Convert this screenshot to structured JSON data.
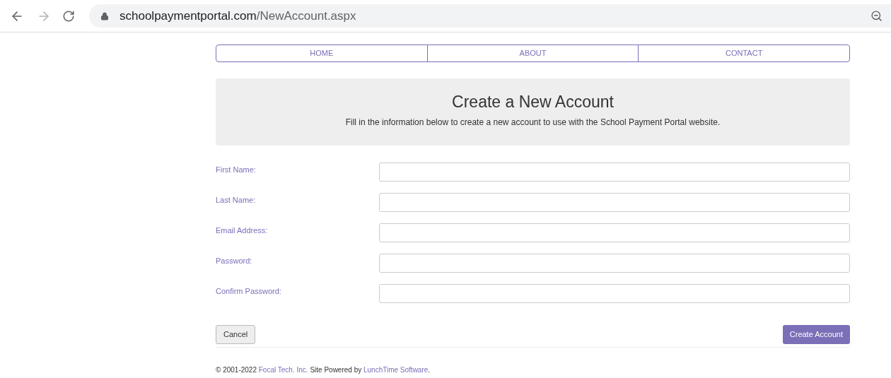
{
  "browser": {
    "url_host": "schoolpaymentportal.com",
    "url_path": "/NewAccount.aspx"
  },
  "nav": [
    "HOME",
    "ABOUT",
    "CONTACT"
  ],
  "header": {
    "title": "Create a New Account",
    "subtitle": "Fill in the information below to create a new account to use with the School Payment Portal website."
  },
  "fields": [
    {
      "label": "First Name:"
    },
    {
      "label": "Last Name:"
    },
    {
      "label": "Email Address:"
    },
    {
      "label": "Password:"
    },
    {
      "label": "Confirm Password:"
    }
  ],
  "buttons": {
    "cancel": "Cancel",
    "submit": "Create Account"
  },
  "footer": [
    {
      "kind": "text",
      "text": "© 2001-2022 "
    },
    {
      "kind": "link",
      "text": "Focal Tech. Inc."
    },
    {
      "kind": "text",
      "text": " Site Powered by "
    },
    {
      "kind": "link",
      "text": "LunchTime Software"
    },
    {
      "kind": "text",
      "text": "."
    }
  ]
}
